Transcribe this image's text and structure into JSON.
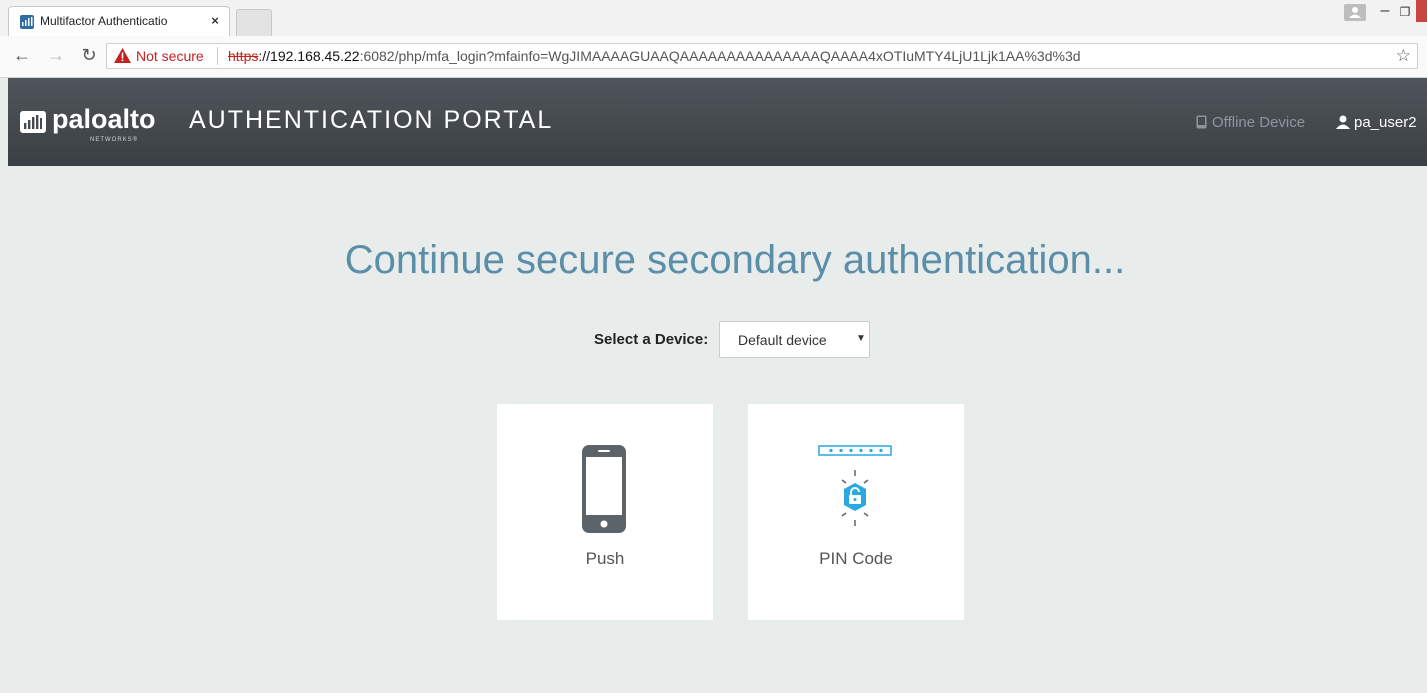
{
  "browser": {
    "tab_title": "Multifactor Authenticatio",
    "tab_close": "×",
    "security_label": "Not secure",
    "url": {
      "scheme": "https",
      "host": "://192.168.45.22",
      "rest": ":6082/php/mfa_login?mfainfo=WgJIMAAAAGUAAQAAAAAAAAAAAAAAAQAAAA4xOTIuMTY4LjU1Ljk1AA%3d%3d"
    },
    "icons": {
      "back": "back-arrow-icon",
      "forward": "forward-arrow-icon",
      "reload": "reload-icon",
      "warning": "warning-icon",
      "bookmark": "star-icon"
    }
  },
  "portal": {
    "logo_text": "paloalto",
    "logo_subtext": "NETWORKS®",
    "title": "AUTHENTICATION PORTAL",
    "offline_device_label": "Offline Device",
    "username": "pa_user2"
  },
  "main": {
    "heading": "Continue secure secondary authentication...",
    "device_label": "Select a Device:",
    "device_select_value": "Default device",
    "methods": [
      {
        "label": "Push",
        "icon": "phone-icon"
      },
      {
        "label": "PIN Code",
        "icon": "pin-lock-icon"
      }
    ]
  },
  "colors": {
    "header_bg": "#454a4f",
    "heading_text": "#5b8ea9",
    "page_bg": "#e8eceb",
    "pin_accent": "#29a9e0",
    "not_secure_red": "#c5221f"
  }
}
